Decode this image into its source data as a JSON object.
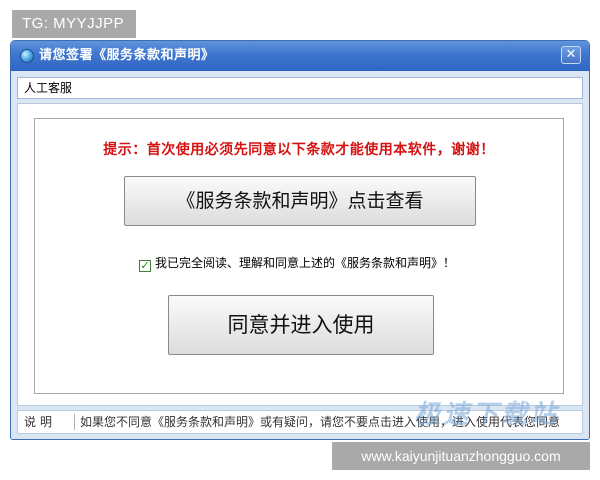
{
  "overlay": {
    "tg_label": "TG: MYYJJPP",
    "url_banner": "www.kaiyunjituanzhongguo.com",
    "watermark_logo": "极速下载站"
  },
  "window": {
    "title": "请您签署《服务条款和声明》",
    "icon": "globe-app-icon",
    "close_glyph": "✕"
  },
  "menubar": {
    "item": "人工客服"
  },
  "dialog": {
    "notice": "提示：首次使用必须先同意以下条款才能使用本软件，谢谢！",
    "terms_button": "《服务条款和声明》点击查看",
    "agree_checkbox": {
      "checked": true,
      "label": "我已完全阅读、理解和同意上述的《服务条款和声明》！"
    },
    "agree_button": "同意并进入使用"
  },
  "statusbar": {
    "label": "说明",
    "text": "如果您不同意《服务条款和声明》或有疑问，请您不要点击进入使用，进入使用代表您同意"
  },
  "colors": {
    "titlebar": "#3e76cf",
    "notice_red": "#d51313",
    "checkmark_green": "#1c8a1c"
  }
}
